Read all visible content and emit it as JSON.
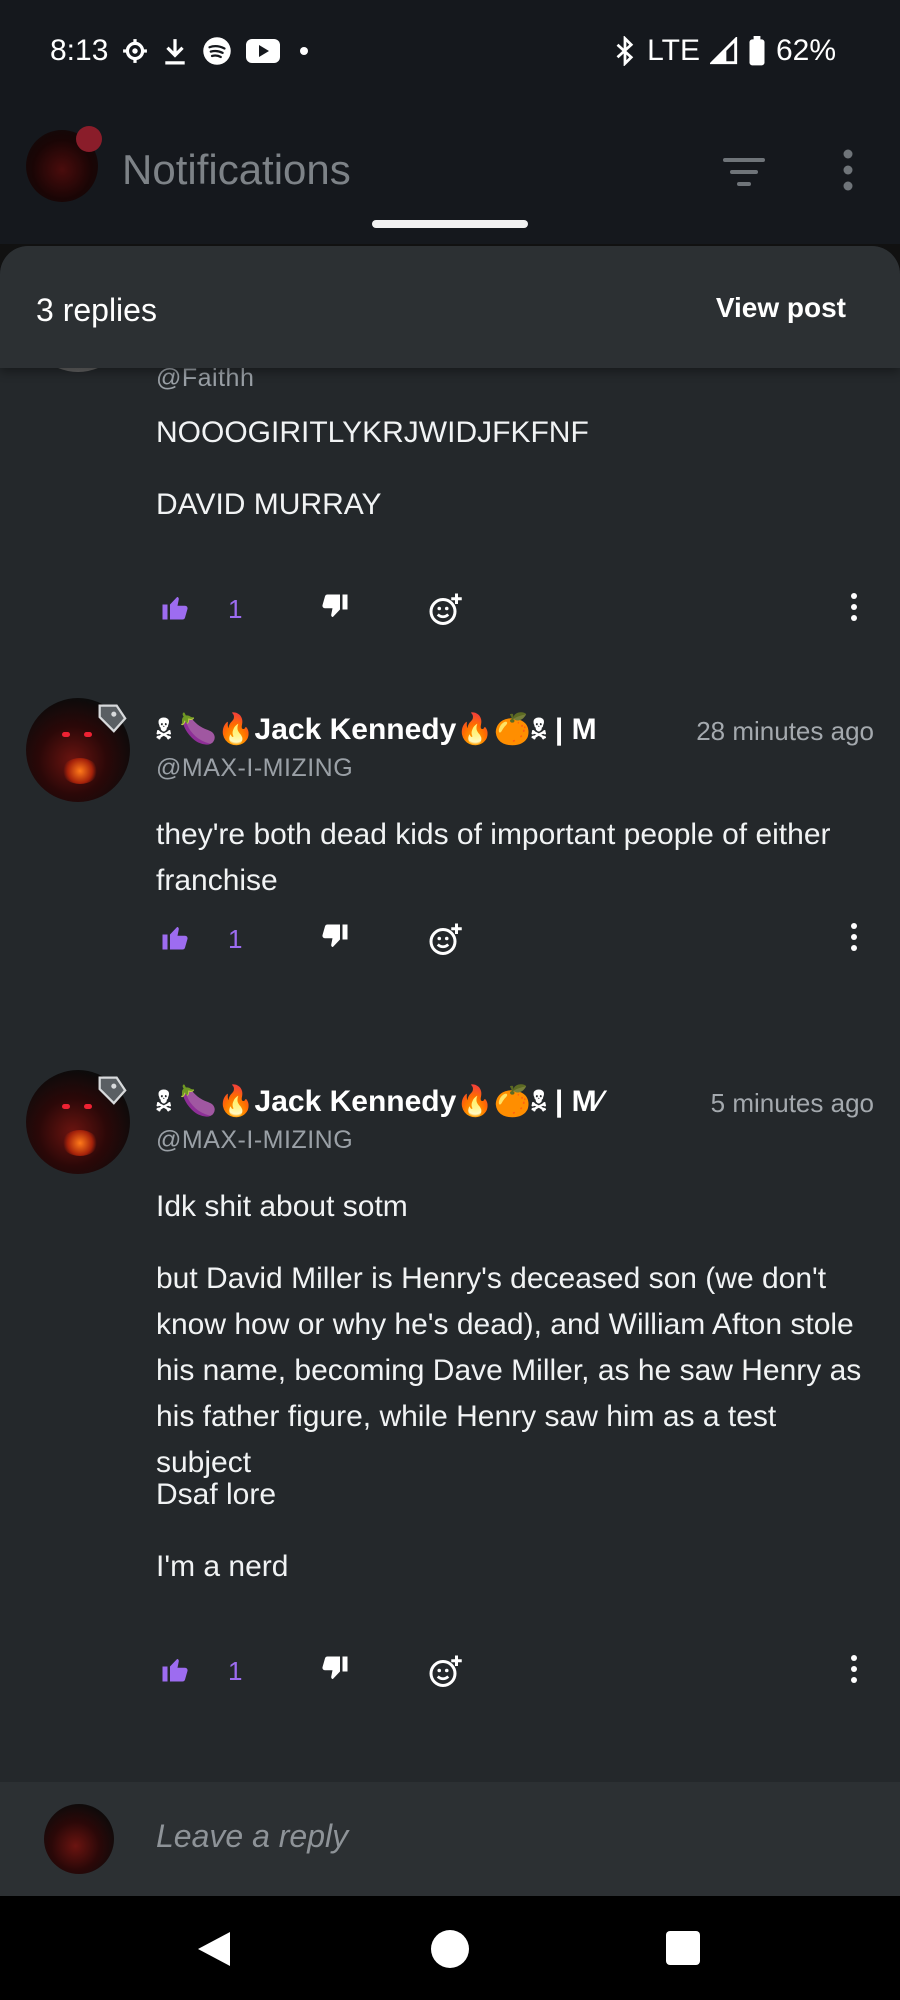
{
  "status_bar": {
    "time": "8:13",
    "network": "LTE",
    "battery": "62%",
    "icons": [
      "settings-icon",
      "download-icon",
      "spotify-icon",
      "youtube-icon",
      "dot-icon",
      "bluetooth-icon",
      "signal-icon",
      "battery-icon"
    ]
  },
  "app_header": {
    "title": "Notifications",
    "icons": [
      "filter-icon",
      "more-vert-icon"
    ]
  },
  "sheet": {
    "title": "3 replies",
    "view_post_label": "View post"
  },
  "comments": [
    {
      "display_name": "",
      "handle": "@Faithh",
      "time": "",
      "paragraphs": [
        "NOOOGIRITLYKRJWIDJFKFNF",
        "DAVID MURRAY"
      ],
      "likes": "1"
    },
    {
      "display_name": "🕱 🍆🔥Jack Kennedy🔥🍊🕱 | M",
      "handle": "@MAX-I-MIZING",
      "time": "28 minutes ago",
      "paragraphs": [
        "they're both dead kids of important people of either franchise"
      ],
      "likes": "1"
    },
    {
      "display_name": "🕱 🍆🔥Jack Kennedy🔥🍊🕱 | M⁄",
      "handle": "@MAX-I-MIZING",
      "time": "5 minutes ago",
      "paragraphs": [
        "Idk shit about sotm",
        "but David Miller is Henry's deceased son (we don't know how or why he's dead), and William Afton stole his name, becoming Dave Miller, as he saw Henry as his father figure, while Henry saw him as a test subject",
        "Dsaf lore",
        "I'm a nerd"
      ],
      "likes": "1"
    }
  ],
  "reply_bar": {
    "placeholder": "Leave a reply"
  },
  "colors": {
    "accent": "#9d6cf0",
    "sheet_bg": "#24282b",
    "header_bg": "#2c3033"
  }
}
